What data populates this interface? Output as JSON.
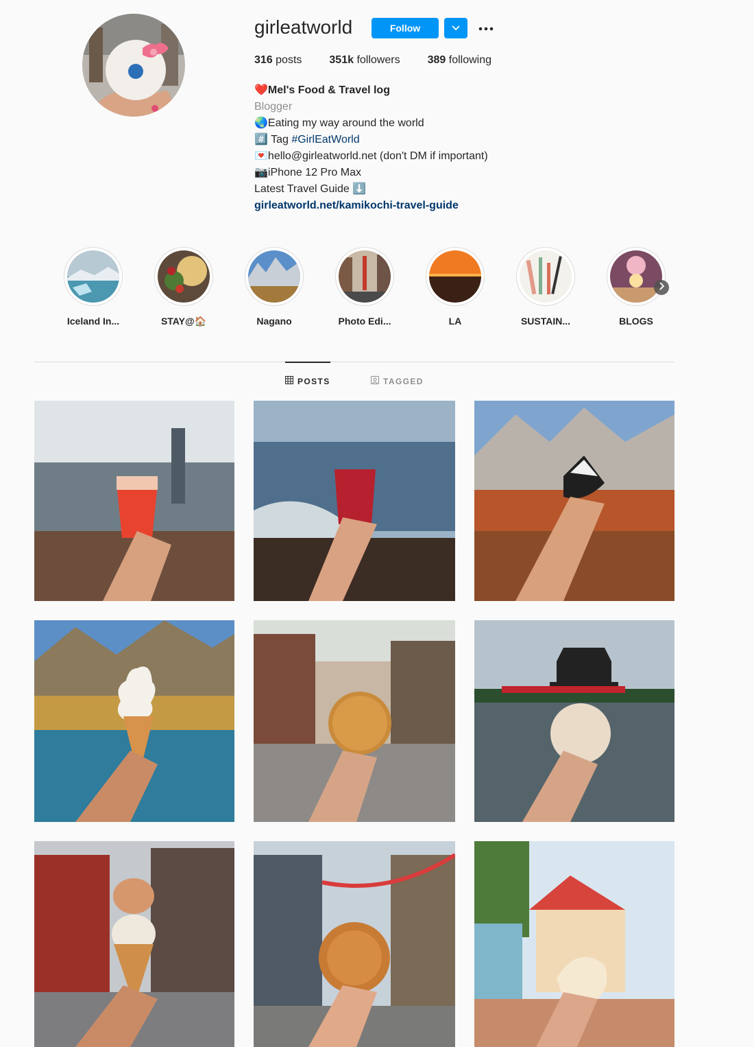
{
  "profile": {
    "username": "girleatworld",
    "follow_label": "Follow",
    "stats": {
      "posts_count": "316",
      "posts_label": "posts",
      "followers_count": "351k",
      "followers_label": "followers",
      "following_count": "389",
      "following_label": "following"
    },
    "bio": {
      "name": "❤️Mel's Food & Travel log",
      "category": "Blogger",
      "line1": "🌏Eating my way around the world",
      "tag_prefix": "#️⃣ Tag ",
      "tag": "#GirlEatWorld",
      "line3": "💌hello@girleatworld.net (don't DM if important)",
      "line4": "📷iPhone 12 Pro Max",
      "line5": "Latest Travel Guide ⬇️",
      "link": "girleatworld.net/kamikochi-travel-guide"
    }
  },
  "highlights": [
    {
      "label": "Iceland In..."
    },
    {
      "label": "STAY@🏠"
    },
    {
      "label": "Nagano"
    },
    {
      "label": "Photo Edi..."
    },
    {
      "label": "LA"
    },
    {
      "label": "SUSTAIN..."
    },
    {
      "label": "BLOGS"
    }
  ],
  "tabs": {
    "posts": "POSTS",
    "tagged": "TAGGED"
  },
  "posts": [
    {
      "icon": "red-cocktail-city-photo"
    },
    {
      "icon": "red-drink-sea-photo"
    },
    {
      "icon": "onigiri-mountain-photo"
    },
    {
      "icon": "soft-serve-river-photo"
    },
    {
      "icon": "rice-cracker-street-photo"
    },
    {
      "icon": "mochi-castle-photo"
    },
    {
      "icon": "pig-ice-cream-street-photo"
    },
    {
      "icon": "mooncake-street-photo"
    },
    {
      "icon": "sandwich-toontown-photo"
    }
  ],
  "colors": {
    "accent": "#0095f6",
    "link": "#00376b",
    "muted": "#8e8e8e"
  }
}
